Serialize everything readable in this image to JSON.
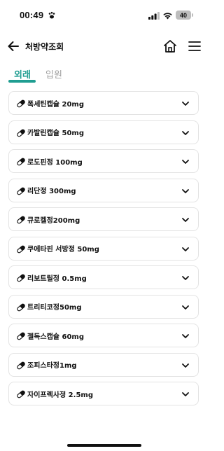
{
  "status_bar": {
    "time": "00:49",
    "battery": "40"
  },
  "header": {
    "title": "처방약조회"
  },
  "tabs": [
    {
      "label": "외래",
      "active": true
    },
    {
      "label": "입원",
      "active": false
    }
  ],
  "drugs": [
    {
      "name": "폭세틴캡슐 20mg"
    },
    {
      "name": "카발린캡슐 50mg"
    },
    {
      "name": "로도핀정 100mg"
    },
    {
      "name": "리단정 300mg"
    },
    {
      "name": "큐로켈정200mg"
    },
    {
      "name": "쿠에타핀 서방정 50mg"
    },
    {
      "name": "리보트릴정 0.5mg"
    },
    {
      "name": "트리티코정50mg"
    },
    {
      "name": "젤독스캡슐 60mg"
    },
    {
      "name": "조피스타정1mg"
    },
    {
      "name": "자이프렉사정 2.5mg"
    }
  ],
  "colors": {
    "accent": "#1f9d91",
    "inactive_tab": "#9e9e9e",
    "border": "#e3e3e3"
  }
}
